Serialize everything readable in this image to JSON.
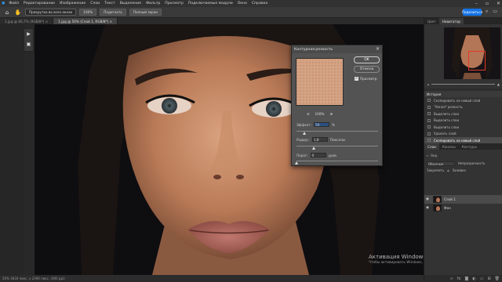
{
  "menu": [
    "Файл",
    "Редактирование",
    "Изображение",
    "Слои",
    "Текст",
    "Выделение",
    "Фильтр",
    "Просмотр",
    "Подключаемые модули",
    "Окно",
    "Справка"
  ],
  "options_bar": {
    "tool_icon": "lasso-icon",
    "btn_sample_all": "Прокрутка во всех окнах",
    "btn_zoom": "100%",
    "btn_fit": "Подогнать",
    "btn_fill": "Полный экран"
  },
  "share_label": "Поделиться",
  "tabs": [
    {
      "label": "1.jpg @ 66,7% (RGB/8*)",
      "active": false
    },
    {
      "label": "1.jpg @ 50% (Слой 1, RGB/8*)",
      "active": true
    }
  ],
  "status": "50%    3634 пикс. x 2394 пикс. (300 ppi)",
  "watermark": {
    "line1": "Активация Windows",
    "line2": "Чтобы активировать Windows, перейдите в раздел \"Параметры\"."
  },
  "dialog": {
    "title": "Контурная резкость",
    "ok": "OK",
    "cancel": "Отмена",
    "preview_label": "Просмотр",
    "preview_checked": true,
    "zoom": "100%",
    "amount_label": "Эффект:",
    "amount_value": "50",
    "amount_unit": "%",
    "amount_fraction": 0.1,
    "radius_label": "Радиус:",
    "radius_value": "1,8",
    "radius_unit": "Пикселы",
    "radius_fraction": 0.22,
    "threshold_label": "Порог:",
    "threshold_value": "0",
    "threshold_unit": "уров.",
    "threshold_fraction": 0.0
  },
  "right_panels": {
    "top_tabs": [
      "Цвет",
      "Навигатор"
    ],
    "history_title": "История",
    "history_items": [
      "Скопировать на новый слой",
      "\"Умная\" резкость",
      "Выделить слои",
      "Выделить слои",
      "Выделить слои",
      "Удалить слой",
      "Скопировать на новый слой"
    ],
    "layers_tabs": [
      "Слои",
      "Каналы",
      "Контуры"
    ],
    "layers_filter": "Вид",
    "blend_mode": "Обычные",
    "opacity_label": "Непрозрачность",
    "lock_label": "Закрепить",
    "fill_label": "Заливка",
    "layers": [
      {
        "name": "Слой 1",
        "active": true
      },
      {
        "name": "Фон",
        "active": false
      }
    ]
  },
  "colors": {
    "accent": "#1473e6",
    "nav_box": "#e23a2a"
  }
}
